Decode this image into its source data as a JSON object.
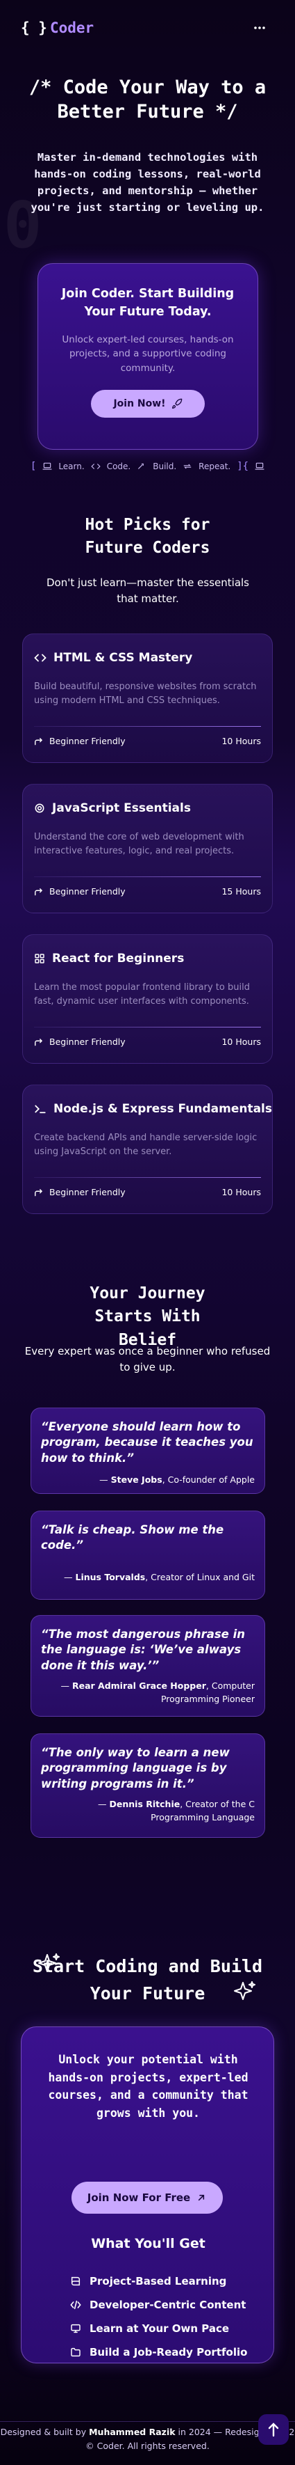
{
  "nav": {
    "logo_braces": "{ }",
    "logo_text": "Coder",
    "menu_icon": "more-dots-icon"
  },
  "hero": {
    "title": "/* Code Your Way to a Better Future */",
    "deco": "0",
    "subtitle": "Master in-demand technologies with hands-on coding lessons, real-world projects, and mentorship — whether you're just starting or leveling up.",
    "cta": {
      "title": "Join Coder. Start Building Your Future Today.",
      "text": "Unlock expert-led courses, hands-on projects, and a supportive coding community.",
      "button": "Join Now!",
      "button_icon": "rocket-icon"
    }
  },
  "ticker": {
    "open": "[",
    "close": "]{",
    "items": [
      {
        "icon": "laptop-icon",
        "label": "Learn."
      },
      {
        "icon": "code-icon",
        "label": "Code."
      },
      {
        "icon": "build-icon",
        "label": "Build."
      },
      {
        "icon": "repeat-icon",
        "label": "Repeat."
      }
    ]
  },
  "hot_picks": {
    "title": "Hot Picks for Future Coders",
    "subtitle": "Don't just learn—master the essentials that matter.",
    "courses": [
      {
        "icon": "code-icon",
        "title": "HTML & CSS Mastery",
        "desc": "Build beautiful, responsive websites from scratch using modern HTML and CSS techniques.",
        "level": "Beginner Friendly",
        "hours": "10 Hours"
      },
      {
        "icon": "gear-icon",
        "title": "JavaScript Essentials",
        "desc": "Understand the core of web development with interactive features, logic, and real projects.",
        "level": "Beginner Friendly",
        "hours": "15 Hours"
      },
      {
        "icon": "react-icon",
        "title": "React for Beginners",
        "desc": "Learn the most popular frontend library to build fast, dynamic user interfaces with components.",
        "level": "Beginner Friendly",
        "hours": "10 Hours"
      },
      {
        "icon": "terminal-icon",
        "title": "Node.js & Express Fundamentals",
        "desc": "Create backend APIs and handle server-side logic using JavaScript on the server.",
        "level": "Beginner Friendly",
        "hours": "10 Hours"
      }
    ]
  },
  "journey": {
    "title": "Your Journey Starts With Belief",
    "subtitle": "Every expert was once a beginner who refused to give up.",
    "quotes": [
      {
        "text": "“Everyone should learn how to program, because it teaches you how to think.”",
        "author": "Steve Jobs",
        "role": ", Co-founder of Apple"
      },
      {
        "text": "“Talk is cheap. Show me the code.”",
        "author": "Linus Torvalds",
        "role": ", Creator of Linux and Git"
      },
      {
        "text": "“The most dangerous phrase in the language is: ‘We’ve always done it this way.’”",
        "author": "Rear Admiral Grace Hopper",
        "role": ", Computer Programming Pioneer"
      },
      {
        "text": "“The only way to learn a new programming language is by writing programs in it.”",
        "author": "Dennis Ritchie",
        "role": ", Creator of the C Programming Language"
      }
    ]
  },
  "start": {
    "title": "Start Coding and Build Your Future",
    "card_text": "Unlock your potential with hands-on projects, expert-led courses, and a community that grows with you.",
    "button": "Join Now For Free",
    "button_icon": "arrow-up-right-icon",
    "features_title": "What You'll Get",
    "features": [
      {
        "icon": "book-icon",
        "label": "Project-Based Learning"
      },
      {
        "icon": "code-icon",
        "label": "Developer-Centric Content"
      },
      {
        "icon": "monitor-icon",
        "label": "Learn at Your Own Pace"
      },
      {
        "icon": "folder-icon",
        "label": "Build a Job-Ready Portfolio"
      }
    ]
  },
  "footer": {
    "line1_prefix": "Designed & built by",
    "author": "Muhammed Razik",
    "line1_middle": "in 2024 — Redesigned in",
    "year": "2",
    "line2": "© Coder. All rights reserved."
  },
  "colors": {
    "accent": "#b18cff",
    "button": "#c9a8ff",
    "card": "#2c0c72"
  }
}
